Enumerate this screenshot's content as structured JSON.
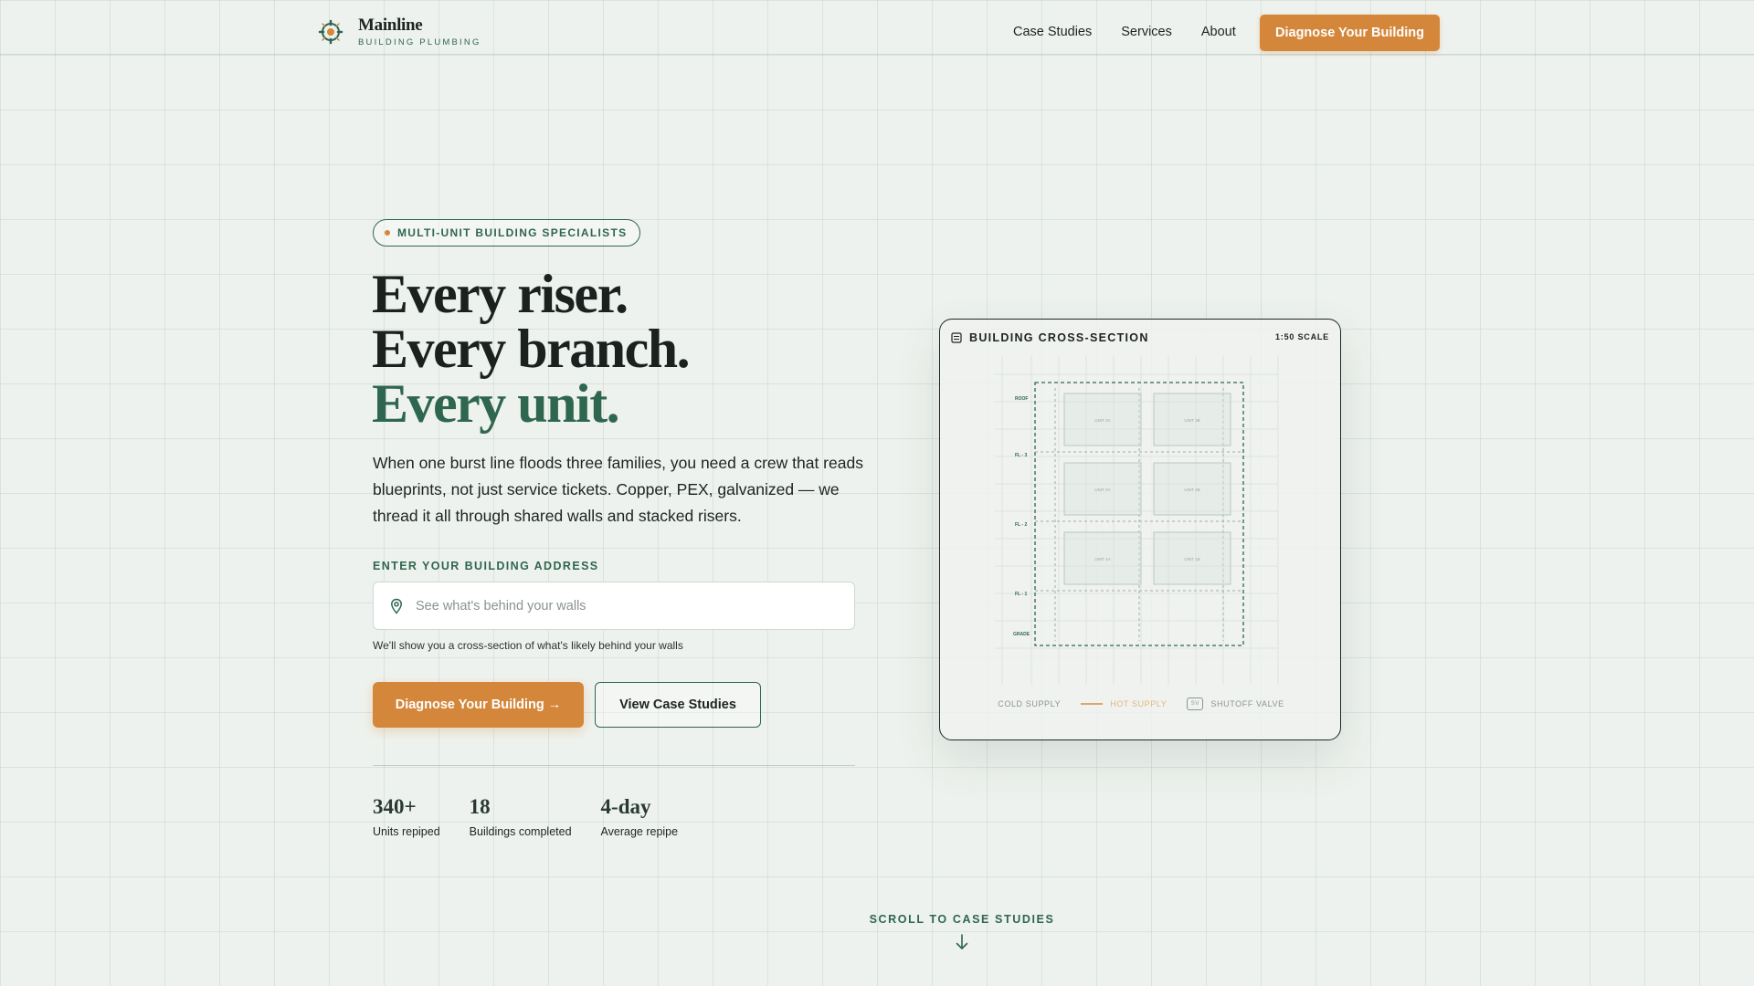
{
  "brand": {
    "name": "Mainline",
    "tagline": "BUILDING PLUMBING"
  },
  "nav": {
    "links": [
      "Case Studies",
      "Services",
      "About"
    ],
    "cta": "Diagnose Your Building"
  },
  "hero": {
    "badge": "MULTI-UNIT BUILDING SPECIALISTS",
    "headline": [
      "Every riser.",
      "Every branch.",
      "Every unit."
    ],
    "lede": "When one burst line floods three families, you need a crew that reads blueprints, not just service tickets. Copper, PEX, galvanized — we thread it all through shared walls and stacked risers.",
    "address_label": "ENTER YOUR BUILDING ADDRESS",
    "address_placeholder": "See what's behind your walls",
    "address_value": "",
    "address_help": "We'll show you a cross-section of what's likely behind your walls",
    "primary_cta": "Diagnose Your Building →",
    "secondary_cta": "View Case Studies"
  },
  "stats": [
    {
      "value": "340+",
      "label": "Units repiped"
    },
    {
      "value": "18",
      "label": "Buildings completed"
    },
    {
      "value": "4-day",
      "label": "Average repipe"
    }
  ],
  "diagram": {
    "title": "BUILDING CROSS-SECTION",
    "scale": "1:50 SCALE",
    "levels": [
      "ROOF",
      "FL - 3",
      "FL - 2",
      "FL - 1",
      "GRADE"
    ],
    "units": [
      "UNIT 3A",
      "UNIT 3B",
      "UNIT 2A",
      "UNIT 2B",
      "UNIT 1A",
      "UNIT 1B"
    ],
    "legend": {
      "cold": "COLD SUPPLY",
      "hot": "HOT SUPPLY",
      "valve_mark": "SV",
      "valve": "SHUTOFF VALVE"
    }
  },
  "scroll": {
    "label": "SCROLL TO CASE STUDIES"
  },
  "colors": {
    "accent": "#d4873a",
    "brand_green": "#2f6650",
    "ink": "#1d2421",
    "background": "#eef2ee"
  }
}
